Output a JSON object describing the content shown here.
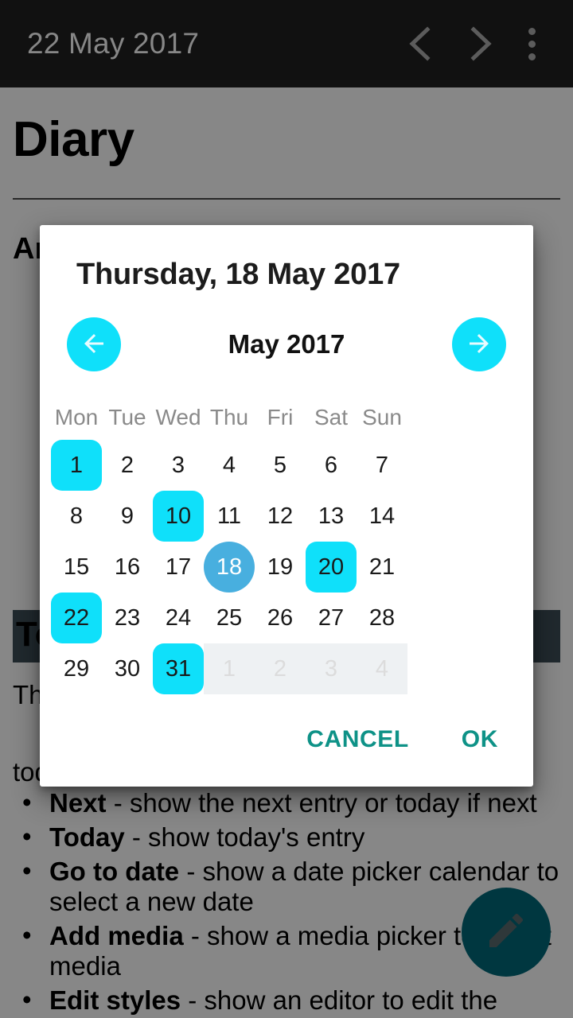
{
  "appbar": {
    "title": "22 May 2017",
    "prev_icon": "chevron-left-icon",
    "next_icon": "chevron-right-icon",
    "overflow_icon": "more-vertical-icon",
    "background": "#111111",
    "text_color": "#878787"
  },
  "page": {
    "heading": "Diary",
    "subheading": "An",
    "section_heading": "To",
    "paragraph": "Th",
    "bullets_intro": "today",
    "bullets": [
      {
        "term": "Next",
        "desc": " - show the next entry or today if next"
      },
      {
        "term": "Today",
        "desc": " - show today's entry"
      },
      {
        "term": "Go to date",
        "desc": " - show a date picker calendar to select a new date"
      },
      {
        "term": "Add media",
        "desc": " - show a media picker to select media"
      },
      {
        "term": "Edit styles",
        "desc": " - show an editor to edit the"
      }
    ],
    "fab_icon": "pencil-icon",
    "fab_color": "#00697a"
  },
  "dialog": {
    "title": "Thursday, 18 May 2017",
    "month_label": "May 2017",
    "prev_month_icon": "arrow-left-icon",
    "next_month_icon": "arrow-right-icon",
    "accent_color": "#0fe0fa",
    "selected_color": "#48afdf",
    "action_color": "#0e9287",
    "weekdays": [
      "Mon",
      "Tue",
      "Wed",
      "Thu",
      "Fri",
      "Sat",
      "Sun"
    ],
    "weeks": [
      [
        {
          "label": "1",
          "state": "highlighted"
        },
        {
          "label": "2",
          "state": "normal"
        },
        {
          "label": "3",
          "state": "normal"
        },
        {
          "label": "4",
          "state": "normal"
        },
        {
          "label": "5",
          "state": "normal"
        },
        {
          "label": "6",
          "state": "normal"
        },
        {
          "label": "7",
          "state": "normal"
        }
      ],
      [
        {
          "label": "8",
          "state": "normal"
        },
        {
          "label": "9",
          "state": "normal"
        },
        {
          "label": "10",
          "state": "highlighted"
        },
        {
          "label": "11",
          "state": "normal"
        },
        {
          "label": "12",
          "state": "normal"
        },
        {
          "label": "13",
          "state": "normal"
        },
        {
          "label": "14",
          "state": "normal"
        }
      ],
      [
        {
          "label": "15",
          "state": "normal"
        },
        {
          "label": "16",
          "state": "normal"
        },
        {
          "label": "17",
          "state": "normal"
        },
        {
          "label": "18",
          "state": "selected"
        },
        {
          "label": "19",
          "state": "normal"
        },
        {
          "label": "20",
          "state": "highlighted"
        },
        {
          "label": "21",
          "state": "normal"
        }
      ],
      [
        {
          "label": "22",
          "state": "highlighted"
        },
        {
          "label": "23",
          "state": "normal"
        },
        {
          "label": "24",
          "state": "normal"
        },
        {
          "label": "25",
          "state": "normal"
        },
        {
          "label": "26",
          "state": "normal"
        },
        {
          "label": "27",
          "state": "normal"
        },
        {
          "label": "28",
          "state": "normal"
        }
      ],
      [
        {
          "label": "29",
          "state": "normal"
        },
        {
          "label": "30",
          "state": "normal"
        },
        {
          "label": "31",
          "state": "highlighted"
        },
        {
          "label": "1",
          "state": "outside"
        },
        {
          "label": "2",
          "state": "outside"
        },
        {
          "label": "3",
          "state": "outside"
        },
        {
          "label": "4",
          "state": "outside"
        }
      ]
    ],
    "cancel_label": "CANCEL",
    "ok_label": "OK"
  }
}
